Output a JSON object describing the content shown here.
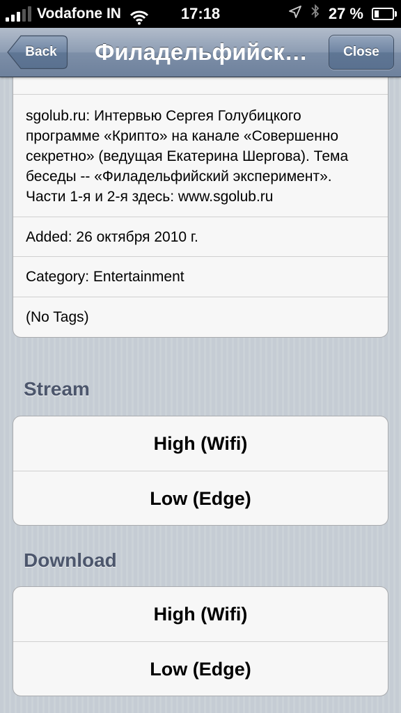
{
  "status_bar": {
    "carrier": "Vodafone IN",
    "time": "17:18",
    "battery": "27 %",
    "battery_level": 0.27
  },
  "nav": {
    "back_label": "Back",
    "title": "Филадельфийск…",
    "close_label": "Close"
  },
  "info": {
    "description": "sgolub.ru: Интервью Сергея Голубицкого программе «Крипто» на канале «Совершенно секретно» (ведущая Екатерина Шергова). Тема беседы -- «Филадельфийский эксперимент». Части 1-я и 2-я здесь: www.sgolub.ru",
    "added": "Added: 26 октября 2010 г.",
    "category": "Category: Entertainment",
    "tags": "(No Tags)"
  },
  "stream": {
    "header": "Stream",
    "high": "High (Wifi)",
    "low": "Low (Edge)"
  },
  "download": {
    "header": "Download",
    "high": "High (Wifi)",
    "low": "Low (Edge)"
  }
}
